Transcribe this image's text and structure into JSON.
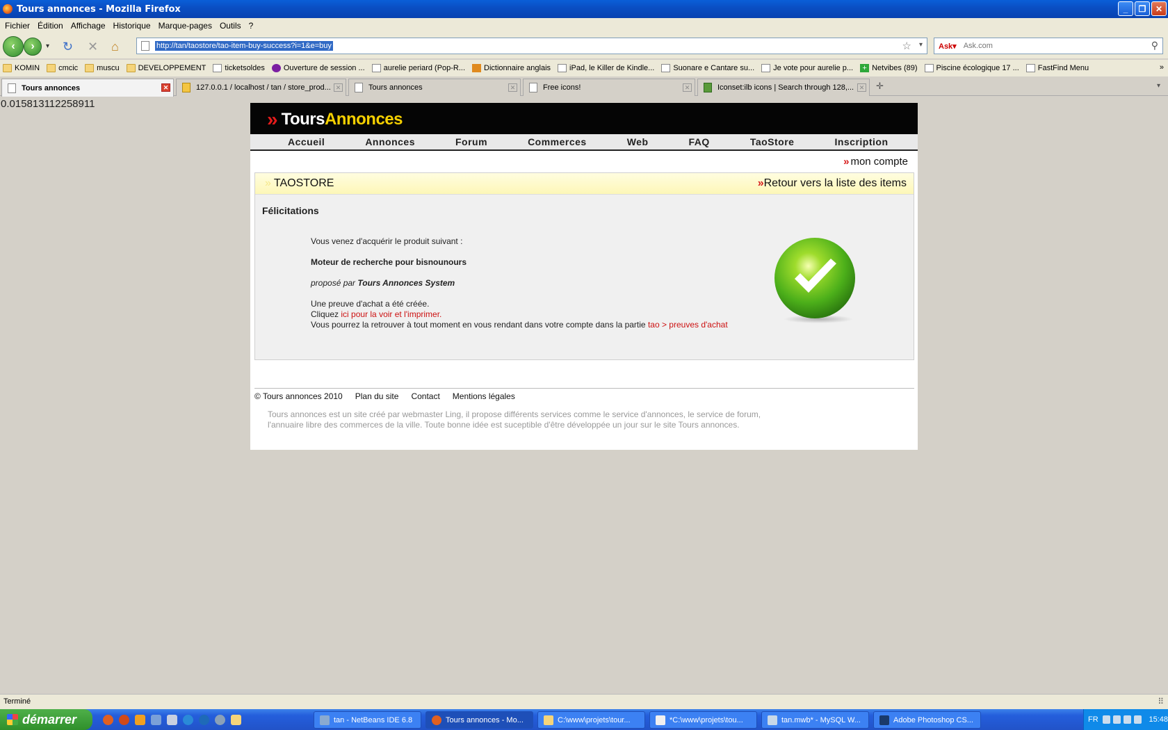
{
  "window": {
    "title": "Tours annonces - Mozilla Firefox"
  },
  "menu": [
    "Fichier",
    "Édition",
    "Affichage",
    "Historique",
    "Marque-pages",
    "Outils",
    "?"
  ],
  "address": {
    "url": "http://tan/taostore/tao-item-buy-success?i=1&e=buy"
  },
  "search": {
    "placeholder": "Ask.com"
  },
  "bookmarks": [
    {
      "label": "KOMIN",
      "icon": "folder"
    },
    {
      "label": "cmcic",
      "icon": "folder"
    },
    {
      "label": "muscu",
      "icon": "folder"
    },
    {
      "label": "DEVELOPPEMENT",
      "icon": "folder"
    },
    {
      "label": "ticketsoldes",
      "icon": "page"
    },
    {
      "label": "Ouverture de session ...",
      "icon": "yahoo"
    },
    {
      "label": "aurelie periard (Pop-R...",
      "icon": "page"
    },
    {
      "label": "Dictionnaire anglais",
      "icon": "wr"
    },
    {
      "label": "iPad, le Killer de Kindle...",
      "icon": "page"
    },
    {
      "label": "Suonare e Cantare su...",
      "icon": "page"
    },
    {
      "label": "Je vote pour aurelie p...",
      "icon": "page"
    },
    {
      "label": "Netvibes (89)",
      "icon": "plus"
    },
    {
      "label": "Piscine écologique 17 ...",
      "icon": "page"
    },
    {
      "label": "FastFind Menu",
      "icon": "page"
    }
  ],
  "tabs": [
    {
      "label": "Tours annonces",
      "active": true
    },
    {
      "label": "127.0.0.1 / localhost / tan / store_prod...",
      "active": false
    },
    {
      "label": "Tours annonces",
      "active": false
    },
    {
      "label": "Free icons!",
      "active": false
    },
    {
      "label": "Iconset:ilb icons | Search through 128,...",
      "active": false
    }
  ],
  "page": {
    "timing": "0.015813112258911",
    "logo": {
      "part1": "Tours",
      "part2": "Annonces"
    },
    "nav": [
      "Accueil",
      "Annonces",
      "Forum",
      "Commerces",
      "Web",
      "FAQ",
      "TaoStore",
      "Inscription"
    ],
    "account_link": "mon compte",
    "panel": {
      "title": "TAOSTORE",
      "back_link": "Retour vers la liste des items",
      "heading": "Félicitations",
      "line1": "Vous venez d'acquérir le produit suivant :",
      "product": "Moteur de recherche pour bisnounours",
      "offered_by_prefix": "proposé par",
      "offered_by": "Tours Annonces System",
      "proof_created": "Une preuve d'achat a été créée.",
      "click_prefix": "Cliquez",
      "print_link": "ici pour la voir et l'imprimer.",
      "retrieve_text": "Vous pourrez la retrouver à tout moment en vous rendant dans votre compte dans la partie",
      "retrieve_link": "tao > preuves d'achat"
    },
    "footer": {
      "copyright": "© Tours annonces 2010",
      "links": [
        "Plan du site",
        "Contact",
        "Mentions légales"
      ],
      "description": "Tours annonces est un site créé par webmaster Ling, il propose différents services comme le service d'annonces, le service de forum, l'annuaire libre des commerces de la ville. Toute bonne idée est suceptible d'être développée un jour sur le site Tours annonces."
    }
  },
  "status": "Terminé",
  "taskbar": {
    "start": "démarrer",
    "tasks": [
      {
        "label": "tan - NetBeans IDE 6.8",
        "active": false
      },
      {
        "label": "Tours annonces - Mo...",
        "active": true
      },
      {
        "label": "C:\\www\\projets\\tour...",
        "active": false
      },
      {
        "label": "*C:\\www\\projets\\tou...",
        "active": false
      },
      {
        "label": "tan.mwb* - MySQL W...",
        "active": false
      },
      {
        "label": "Adobe Photoshop CS...",
        "active": false
      }
    ],
    "lang": "FR",
    "clock": "15:48"
  },
  "colors": {
    "accent_red": "#cc1111",
    "logo_yellow": "#f5d000",
    "xp_blue": "#245edc",
    "success_green": "#4caf1a"
  }
}
